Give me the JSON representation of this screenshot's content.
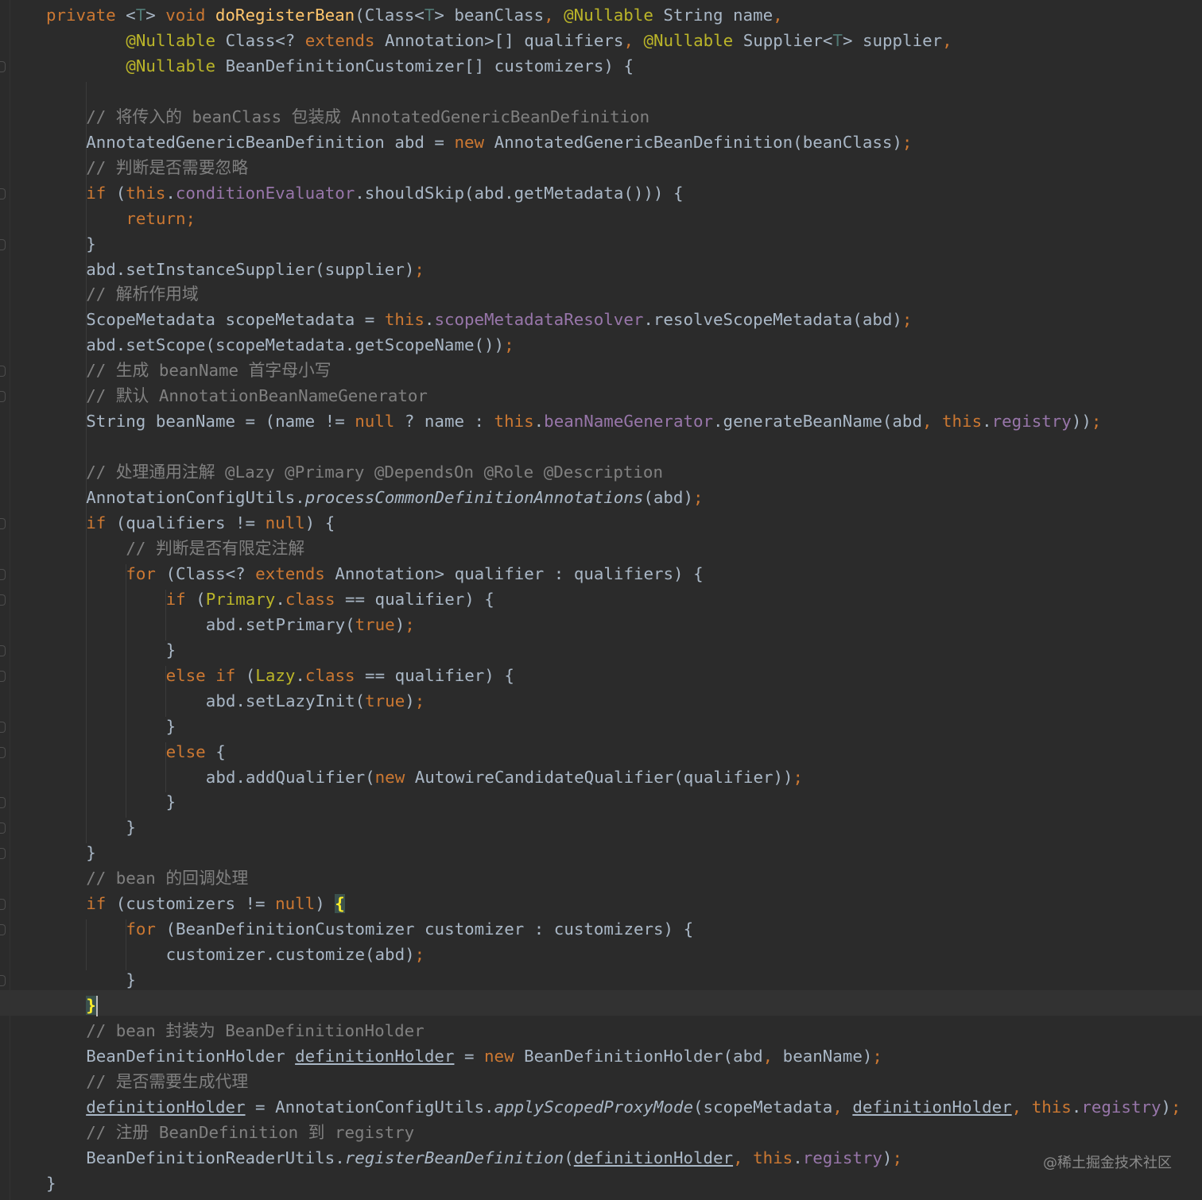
{
  "editor": {
    "theme": "dark",
    "colors": {
      "background": "#2b2b2b",
      "text": "#a9b7c6",
      "keyword": "#cc7832",
      "annotation": "#bbb529",
      "method_declaration": "#ffc66d",
      "field": "#9876aa",
      "comment": "#808080",
      "type_parameter": "#507874",
      "current_line": "#323232"
    },
    "lines": [
      [
        [
          "private ",
          "kw"
        ],
        [
          "<",
          ""
        ],
        [
          "T",
          "tp"
        ],
        [
          "> ",
          ""
        ],
        [
          "void ",
          "kw"
        ],
        [
          "doRegisterBean",
          "fn"
        ],
        [
          "(Class<",
          ""
        ],
        [
          "T",
          "tp"
        ],
        [
          "> beanClass",
          ""
        ],
        [
          ", ",
          "kw"
        ],
        [
          "@Nullable ",
          "ann"
        ],
        [
          "String name",
          ""
        ],
        [
          ",",
          "kw"
        ]
      ],
      [
        [
          "@Nullable ",
          "ann"
        ],
        [
          "Class<? ",
          ""
        ],
        [
          "extends ",
          "kw"
        ],
        [
          "Annotation>[] qualifiers",
          ""
        ],
        [
          ", ",
          "kw"
        ],
        [
          "@Nullable ",
          "ann"
        ],
        [
          "Supplier<",
          ""
        ],
        [
          "T",
          "tp"
        ],
        [
          "> supplier",
          ""
        ],
        [
          ",",
          "kw"
        ]
      ],
      [
        [
          "@Nullable ",
          "ann"
        ],
        [
          "BeanDefinitionCustomizer[] customizers) {",
          ""
        ]
      ],
      [],
      [
        [
          "// 将传入的 beanClass 包装成 AnnotatedGenericBeanDefinition",
          "cm"
        ]
      ],
      [
        [
          "AnnotatedGenericBeanDefinition abd = ",
          ""
        ],
        [
          "new ",
          "kw"
        ],
        [
          "AnnotatedGenericBeanDefinition(beanClass)",
          ""
        ],
        [
          ";",
          "kw"
        ]
      ],
      [
        [
          "// 判断是否需要忽略",
          "cm"
        ]
      ],
      [
        [
          "if ",
          "kw"
        ],
        [
          "(",
          ""
        ],
        [
          "this",
          "kw"
        ],
        [
          ".",
          ""
        ],
        [
          "conditionEvaluator",
          "fld"
        ],
        [
          ".shouldSkip(abd.getMetadata())) {",
          ""
        ]
      ],
      [
        [
          "return",
          "kw"
        ],
        [
          ";",
          "kw"
        ]
      ],
      [
        [
          "}",
          ""
        ]
      ],
      [
        [
          "abd.setInstanceSupplier(supplier)",
          ""
        ],
        [
          ";",
          "kw"
        ]
      ],
      [
        [
          "// 解析作用域",
          "cm"
        ]
      ],
      [
        [
          "ScopeMetadata scopeMetadata = ",
          ""
        ],
        [
          "this",
          "kw"
        ],
        [
          ".",
          ""
        ],
        [
          "scopeMetadataResolver",
          "fld"
        ],
        [
          ".resolveScopeMetadata(abd)",
          ""
        ],
        [
          ";",
          "kw"
        ]
      ],
      [
        [
          "abd.setScope(scopeMetadata.getScopeName())",
          ""
        ],
        [
          ";",
          "kw"
        ]
      ],
      [
        [
          "// 生成 beanName 首字母小写",
          "cm"
        ]
      ],
      [
        [
          "// 默认 AnnotationBeanNameGenerator",
          "cm"
        ]
      ],
      [
        [
          "String beanName = (name != ",
          ""
        ],
        [
          "null ",
          "kw"
        ],
        [
          "? name : ",
          ""
        ],
        [
          "this",
          "kw"
        ],
        [
          ".",
          ""
        ],
        [
          "beanNameGenerator",
          "fld"
        ],
        [
          ".generateBeanName(abd",
          ""
        ],
        [
          ", ",
          "kw"
        ],
        [
          "this",
          "kw"
        ],
        [
          ".",
          ""
        ],
        [
          "registry",
          "fld"
        ],
        [
          "))",
          ""
        ],
        [
          ";",
          "kw"
        ]
      ],
      [],
      [
        [
          "// 处理通用注解 @Lazy @Primary @DependsOn @Role @Description",
          "cm"
        ]
      ],
      [
        [
          "AnnotationConfigUtils.",
          ""
        ],
        [
          "processCommonDefinitionAnnotations",
          "it"
        ],
        [
          "(abd)",
          ""
        ],
        [
          ";",
          "kw"
        ]
      ],
      [
        [
          "if ",
          "kw"
        ],
        [
          "(qualifiers != ",
          ""
        ],
        [
          "null",
          "kw"
        ],
        [
          ") {",
          ""
        ]
      ],
      [
        [
          "// 判断是否有限定注解",
          "cm"
        ]
      ],
      [
        [
          "for ",
          "kw"
        ],
        [
          "(Class<? ",
          ""
        ],
        [
          "extends ",
          "kw"
        ],
        [
          "Annotation> qualifier : qualifiers) {",
          ""
        ]
      ],
      [
        [
          "if ",
          "kw"
        ],
        [
          "(",
          ""
        ],
        [
          "Primary",
          "ann"
        ],
        [
          ".",
          ""
        ],
        [
          "class ",
          "kw"
        ],
        [
          "== qualifier) {",
          ""
        ]
      ],
      [
        [
          "abd.setPrimary(",
          ""
        ],
        [
          "true",
          "kw"
        ],
        [
          ")",
          ""
        ],
        [
          ";",
          "kw"
        ]
      ],
      [
        [
          "}",
          ""
        ]
      ],
      [
        [
          "else if ",
          "kw"
        ],
        [
          "(",
          ""
        ],
        [
          "Lazy",
          "ann"
        ],
        [
          ".",
          ""
        ],
        [
          "class ",
          "kw"
        ],
        [
          "== qualifier) {",
          ""
        ]
      ],
      [
        [
          "abd.setLazyInit(",
          ""
        ],
        [
          "true",
          "kw"
        ],
        [
          ")",
          ""
        ],
        [
          ";",
          "kw"
        ]
      ],
      [
        [
          "}",
          ""
        ]
      ],
      [
        [
          "else ",
          "kw"
        ],
        [
          "{",
          ""
        ]
      ],
      [
        [
          "abd.addQualifier(",
          ""
        ],
        [
          "new ",
          "kw"
        ],
        [
          "AutowireCandidateQualifier(qualifier))",
          ""
        ],
        [
          ";",
          "kw"
        ]
      ],
      [
        [
          "}",
          ""
        ]
      ],
      [
        [
          "}",
          ""
        ]
      ],
      [
        [
          "}",
          ""
        ]
      ],
      [
        [
          "// bean 的回调处理",
          "cm"
        ]
      ],
      [
        [
          "if ",
          "kw"
        ],
        [
          "(customizers != ",
          ""
        ],
        [
          "null",
          "kw"
        ],
        [
          ") ",
          ""
        ],
        [
          "{",
          "brace-hl"
        ]
      ],
      [
        [
          "for ",
          "kw"
        ],
        [
          "(BeanDefinitionCustomizer customizer : customizers) {",
          ""
        ]
      ],
      [
        [
          "customizer.customize(abd)",
          ""
        ],
        [
          ";",
          "kw"
        ]
      ],
      [
        [
          "}",
          ""
        ]
      ],
      [
        [
          "}",
          "brace-hl"
        ],
        [
          "",
          "caret"
        ]
      ],
      [
        [
          "// bean 封装为 BeanDefinitionHolder",
          "cm"
        ]
      ],
      [
        [
          "BeanDefinitionHolder ",
          ""
        ],
        [
          "definitionHolder",
          "ul"
        ],
        [
          " = ",
          ""
        ],
        [
          "new ",
          "kw"
        ],
        [
          "BeanDefinitionHolder(abd",
          ""
        ],
        [
          ", ",
          "kw"
        ],
        [
          "beanName)",
          ""
        ],
        [
          ";",
          "kw"
        ]
      ],
      [
        [
          "// 是否需要生成代理",
          "cm"
        ]
      ],
      [
        [
          "definitionHolder",
          "ul"
        ],
        [
          " = AnnotationConfigUtils.",
          ""
        ],
        [
          "applyScopedProxyMode",
          "it"
        ],
        [
          "(scopeMetadata",
          ""
        ],
        [
          ", ",
          "kw"
        ],
        [
          "definitionHolder",
          "ul"
        ],
        [
          ", ",
          "kw"
        ],
        [
          "this",
          "kw"
        ],
        [
          ".",
          ""
        ],
        [
          "registry",
          "fld"
        ],
        [
          ")",
          ""
        ],
        [
          ";",
          "kw"
        ]
      ],
      [
        [
          "// 注册 BeanDefinition 到 registry",
          "cm"
        ]
      ],
      [
        [
          "BeanDefinitionReaderUtils.",
          ""
        ],
        [
          "registerBeanDefinition",
          "it"
        ],
        [
          "(",
          ""
        ],
        [
          "definitionHolder",
          "ul"
        ],
        [
          ", ",
          "kw"
        ],
        [
          "this",
          "kw"
        ],
        [
          ".",
          ""
        ],
        [
          "registry",
          "fld"
        ],
        [
          ")",
          ""
        ],
        [
          ";",
          "kw"
        ]
      ],
      [
        [
          "}",
          ""
        ]
      ]
    ]
  },
  "watermark": "@稀土掘金技术社区"
}
